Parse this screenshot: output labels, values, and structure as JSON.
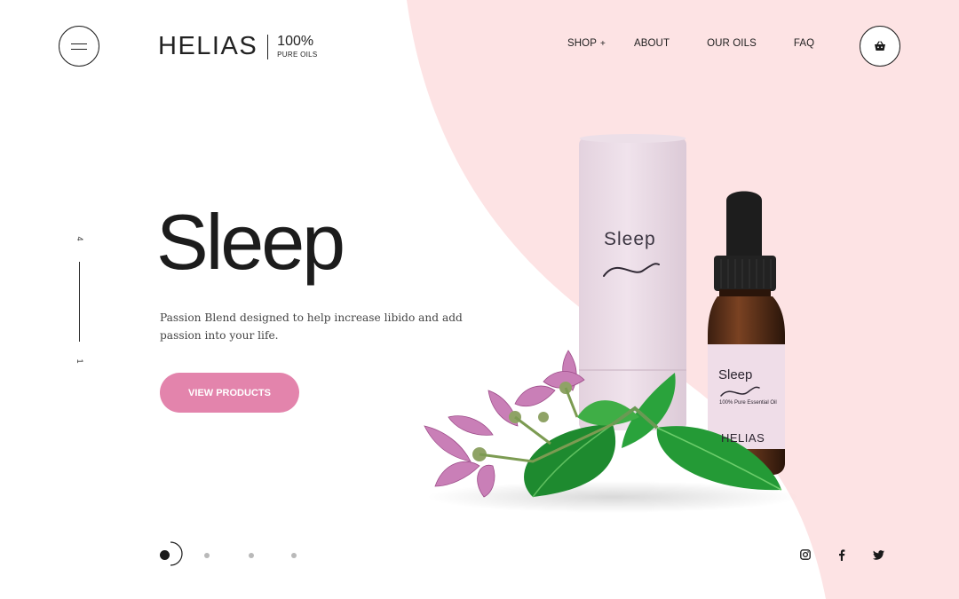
{
  "brand": {
    "name": "HELIAS",
    "tag_big": "100%",
    "tag_small": "PURE OILS"
  },
  "nav": {
    "items": [
      {
        "label": "SHOP",
        "has_submenu": true,
        "submenu_glyph": "+"
      },
      {
        "label": "ABOUT"
      },
      {
        "label": "OUR OILS"
      },
      {
        "label": "FAQ"
      }
    ]
  },
  "icons": {
    "menu": "hamburger-icon",
    "cart": "basket-icon",
    "instagram": "instagram-icon",
    "facebook": "facebook-icon",
    "twitter": "twitter-icon"
  },
  "slider": {
    "counter_total": "4",
    "counter_current": "1",
    "total_dots": 4,
    "active_index": 0
  },
  "hero": {
    "title": "Sleep",
    "description": "Passion Blend designed to help increase libido and add passion into your life.",
    "cta_label": "VIEW PRODUCTS"
  },
  "product": {
    "tube_label": "Sleep",
    "bottle_label": "Sleep",
    "bottle_sub": "100% Pure Essential Oil",
    "bottle_brand": "HELIAS"
  },
  "colors": {
    "accent_pink": "#e384ac",
    "background_blush": "#fde3e4",
    "text_dark": "#1f1f1f",
    "packaging_lilac": "#eadbe4"
  }
}
